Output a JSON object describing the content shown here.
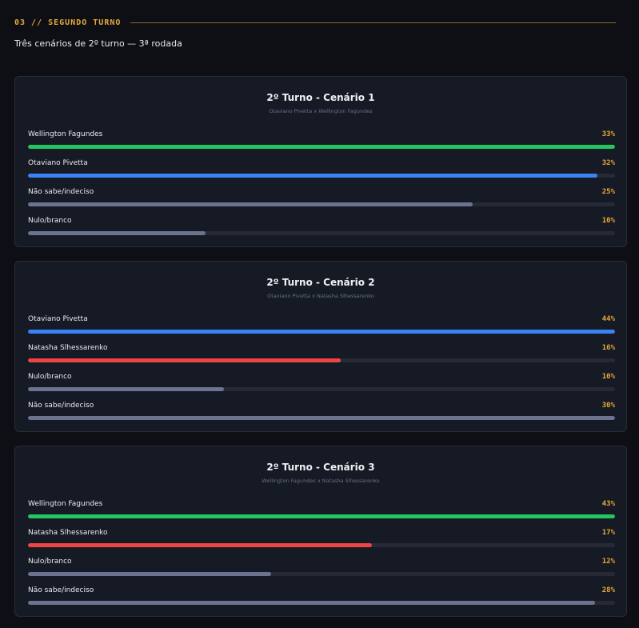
{
  "section": {
    "label": "03 // SEGUNDO TURNO",
    "subtitle": "Três cenários de 2º turno — 3ª rodada"
  },
  "colors": {
    "green": "#22c55e",
    "blue": "#3b82f6",
    "red": "#ef4444",
    "gray": "#6b7390",
    "accent": "#e6a93a"
  },
  "chart_data": [
    {
      "type": "bar",
      "title": "2º Turno - Cenário 1",
      "subtitle": "Otaviano Pivetta x Wellington Fagundes",
      "categories": [
        "Wellington Fagundes",
        "Otaviano Pivetta",
        "Não sabe/indeciso",
        "Nulo/branco"
      ],
      "values": [
        33,
        32,
        25,
        10
      ],
      "labels": [
        "33%",
        "32%",
        "25%",
        "10%"
      ],
      "colors": [
        "green",
        "blue",
        "gray",
        "gray"
      ],
      "xlim": [
        0,
        33
      ]
    },
    {
      "type": "bar",
      "title": "2º Turno - Cenário 2",
      "subtitle": "Otaviano Pivetta x Natasha Slhessarenko",
      "categories": [
        "Otaviano Pivetta",
        "Natasha Slhessarenko",
        "Nulo/branco",
        "Não sabe/indeciso"
      ],
      "values": [
        44,
        16,
        10,
        30
      ],
      "labels": [
        "44%",
        "16%",
        "10%",
        "30%"
      ],
      "colors": [
        "blue",
        "red",
        "gray",
        "gray"
      ],
      "xlim": [
        0,
        30
      ]
    },
    {
      "type": "bar",
      "title": "2º Turno - Cenário 3",
      "subtitle": "Wellington Fagundes x Natasha Slhessarenko",
      "categories": [
        "Wellington Fagundes",
        "Natasha Slhessarenko",
        "Nulo/branco",
        "Não sabe/indeciso"
      ],
      "values": [
        43,
        17,
        12,
        28
      ],
      "labels": [
        "43%",
        "17%",
        "12%",
        "28%"
      ],
      "colors": [
        "green",
        "red",
        "gray",
        "gray"
      ],
      "xlim": [
        0,
        29
      ]
    }
  ]
}
